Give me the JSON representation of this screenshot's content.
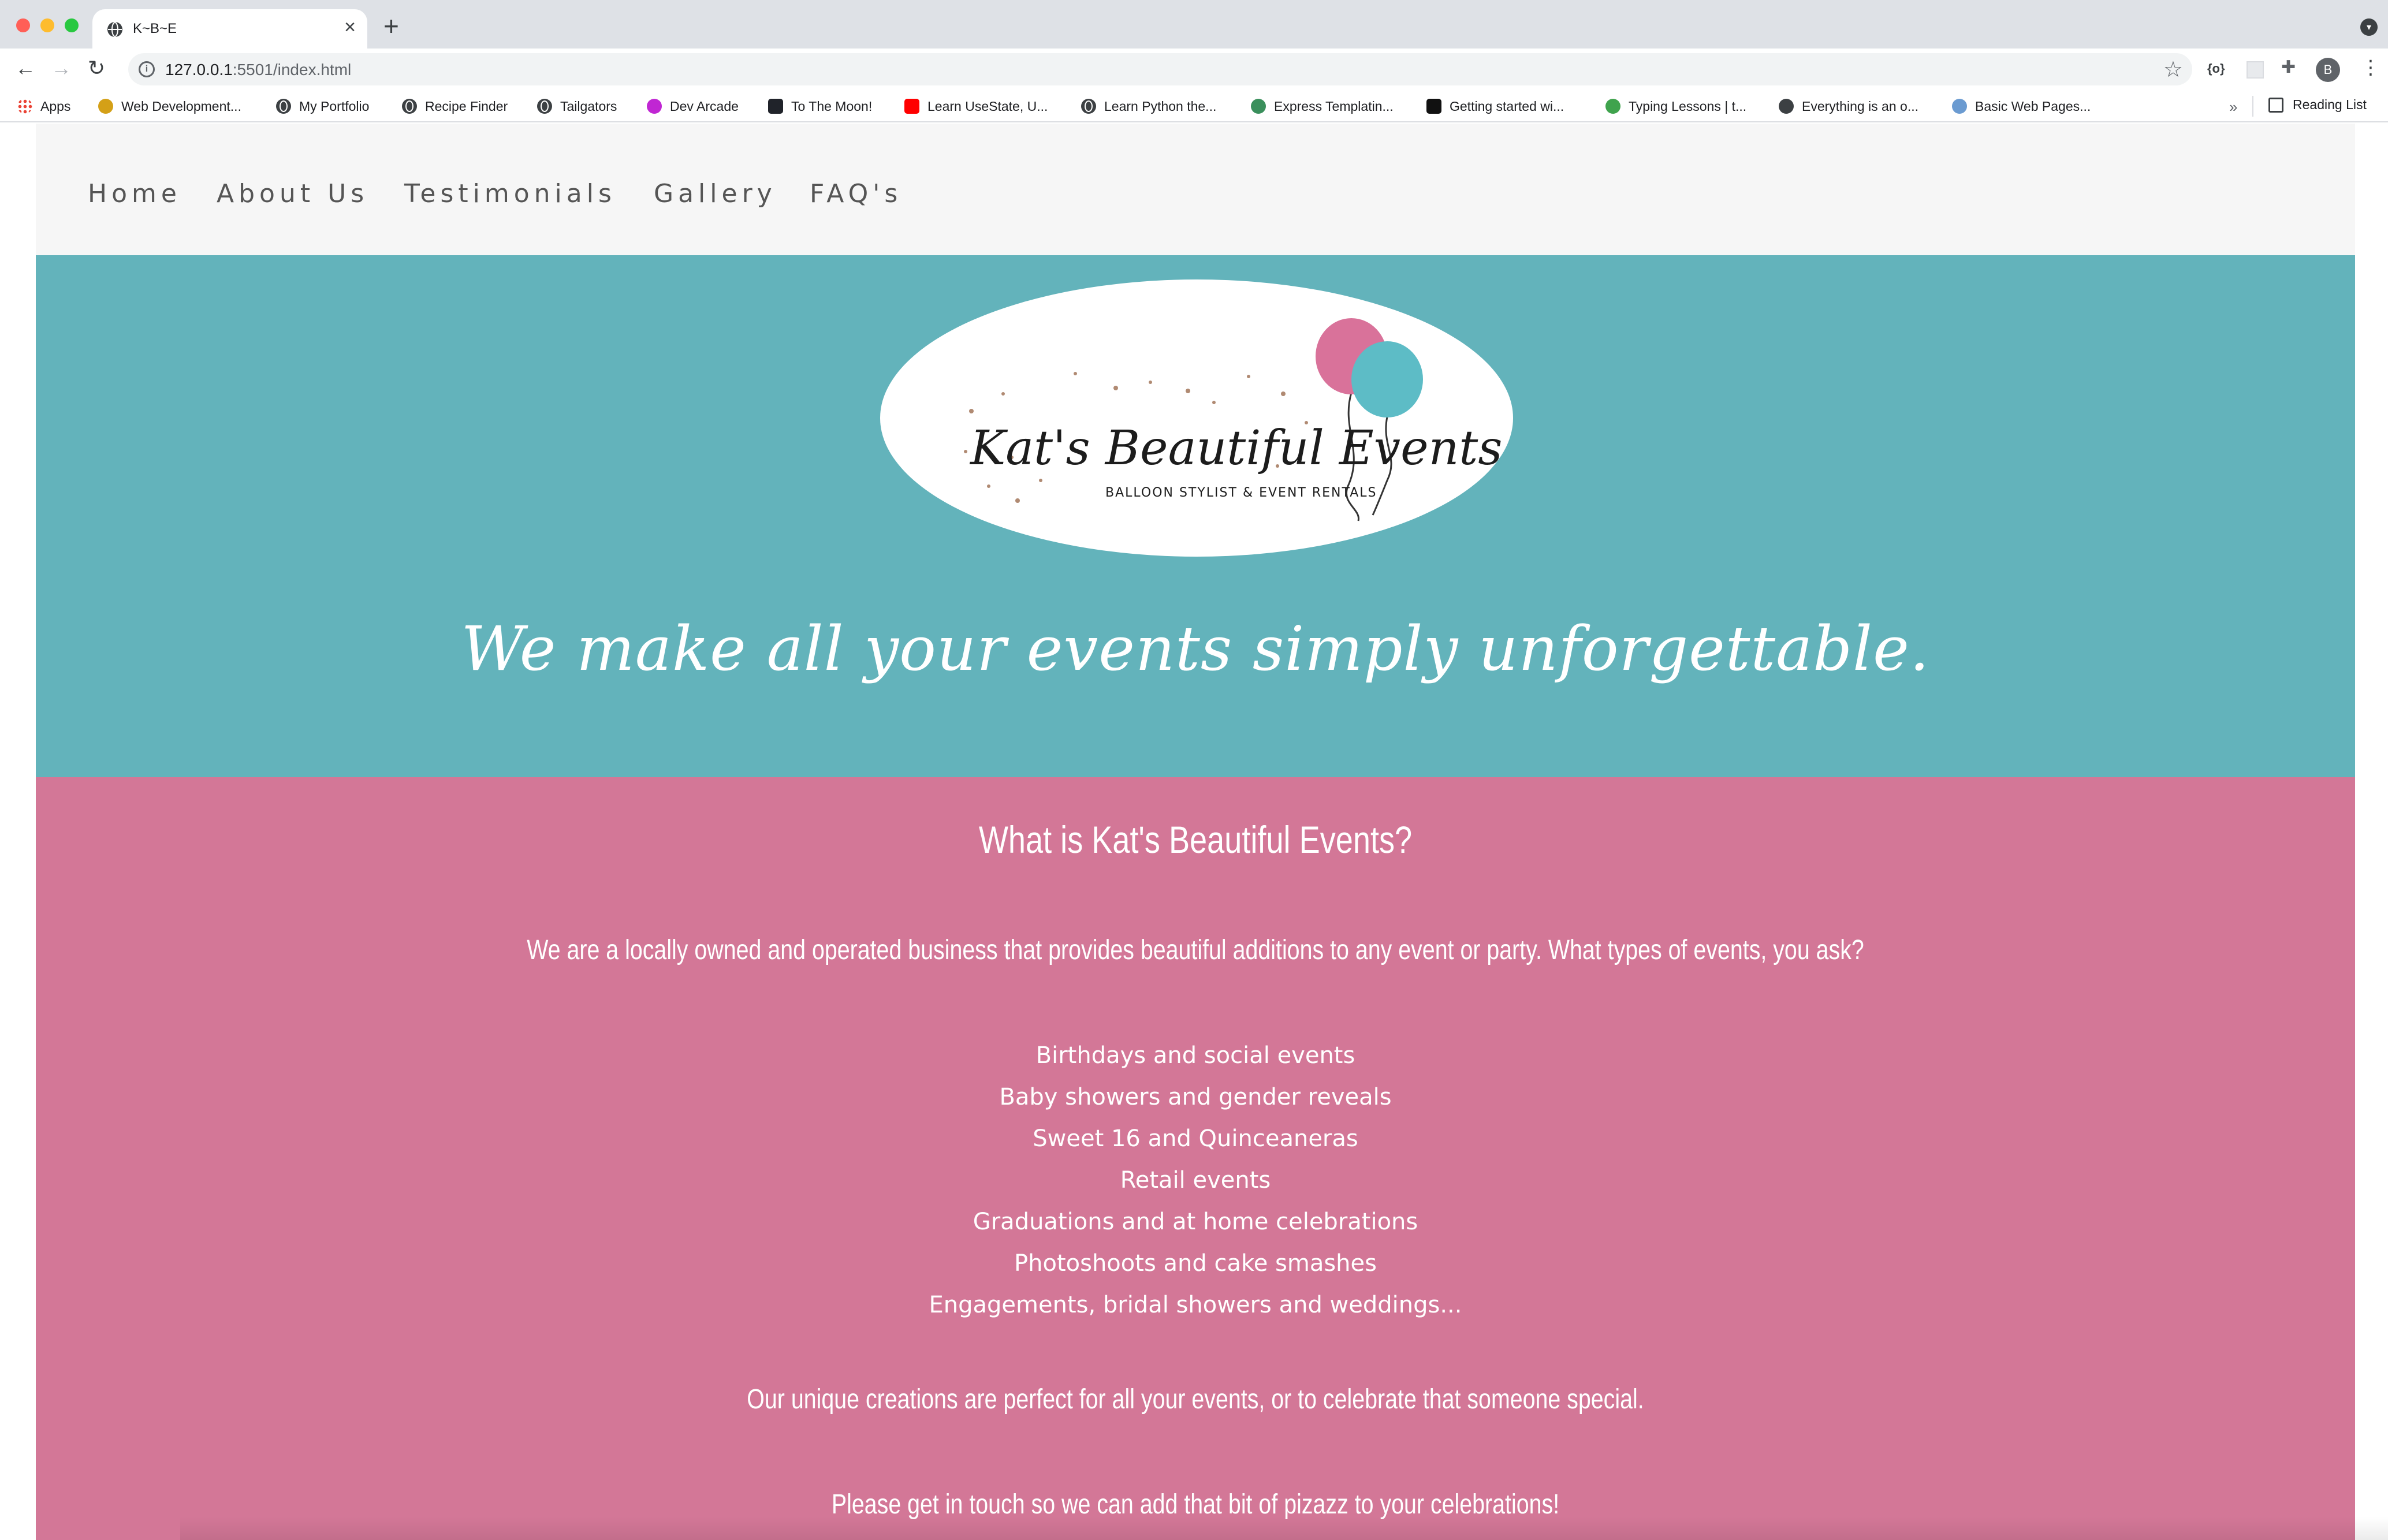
{
  "browser": {
    "tab_title": "K~B~E",
    "tab_close": "×",
    "new_tab": "+",
    "url_host": "127.0.0.1",
    "url_rest": ":5501/index.html",
    "bookmarks": [
      {
        "label": "Apps",
        "icon": "apps-grid-icon"
      },
      {
        "label": "Web Development...",
        "icon": "web-dev-icon"
      },
      {
        "label": "My Portfolio",
        "icon": "globe-icon"
      },
      {
        "label": "Recipe Finder",
        "icon": "globe-icon"
      },
      {
        "label": "Tailgators",
        "icon": "globe-icon"
      },
      {
        "label": "Dev Arcade",
        "icon": "dev-arcade-icon"
      },
      {
        "label": "To The Moon!",
        "icon": "react-icon"
      },
      {
        "label": "Learn UseState, U...",
        "icon": "youtube-icon"
      },
      {
        "label": "Learn Python the...",
        "icon": "globe-icon"
      },
      {
        "label": "Express Templatin...",
        "icon": "link-icon"
      },
      {
        "label": "Getting started wi...",
        "icon": "chat-icon"
      },
      {
        "label": "Typing Lessons | t...",
        "icon": "typing-t-icon"
      },
      {
        "label": "Everything is an o...",
        "icon": "anchor-icon"
      },
      {
        "label": "Basic Web Pages...",
        "icon": "mdn-icon"
      }
    ],
    "bookmarks_more": "»",
    "reading_list": "Reading List",
    "avatar_letter": "B",
    "ext_braces": "{o}"
  },
  "site": {
    "nav": [
      "Home",
      "About Us",
      "Testimonials",
      "Gallery",
      "FAQ's"
    ],
    "logo": {
      "name": "Kat's Beautiful Events",
      "subtitle": "BALLOON STYLIST & EVENT RENTALS"
    },
    "tagline": "We make all your events simply unforgettable.",
    "about": {
      "title": "What is Kat's Beautiful Events?",
      "intro": "We are a locally owned and operated business that provides beautiful additions to any event or party. What types of events, you ask?",
      "events": [
        "Birthdays and social events",
        "Baby showers and gender reveals",
        "Sweet 16 and Quinceaneras",
        "Retail events",
        "Graduations and at home celebrations",
        "Photoshoots and cake smashes",
        "Engagements, bridal showers and weddings..."
      ],
      "unique": "Our unique creations are perfect for all your events, or to celebrate that someone special.",
      "contact": "Please get in touch so we can add that bit of pizazz to your celebrations!"
    }
  },
  "colors": {
    "nav_bg": "#f6f6f6",
    "hero_teal": "#63b3bb",
    "about_pink": "#d37797",
    "balloon_pink": "#d9729a",
    "balloon_teal": "#5dbcc6"
  }
}
